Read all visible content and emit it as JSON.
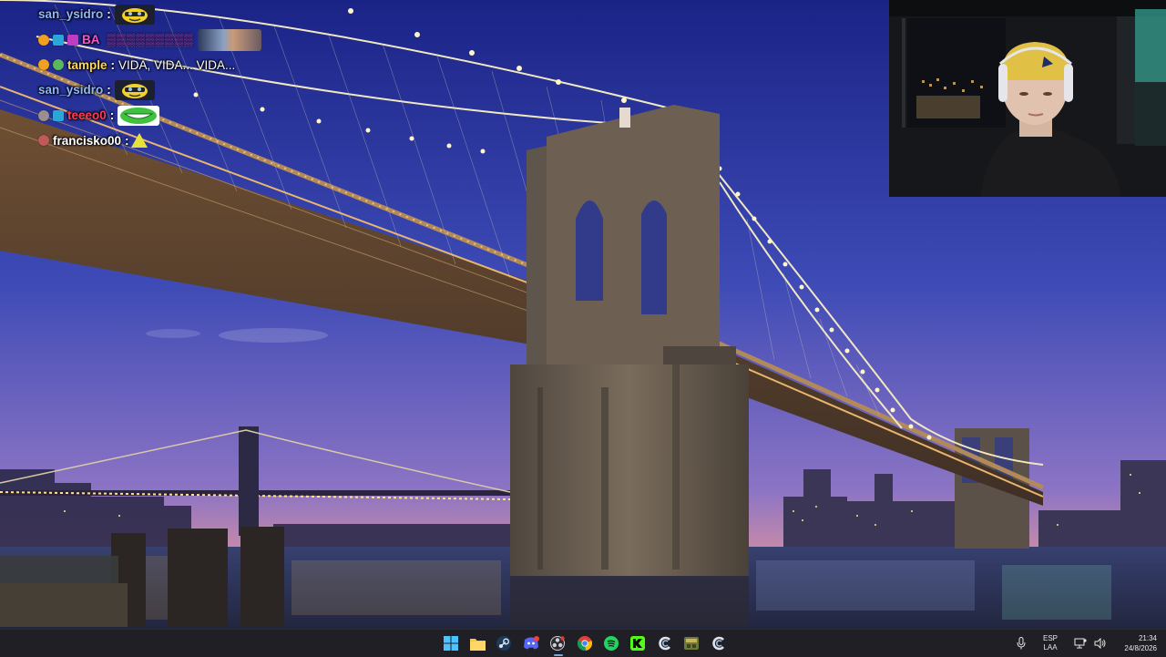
{
  "chat": {
    "messages": [
      {
        "username": "san_ysidro",
        "separator": ":",
        "text": "",
        "username_color": "#8fb7ff",
        "emote": "pepe-emote"
      },
      {
        "username": "BA",
        "separator": "",
        "text": "",
        "username_color": "#ff4fd8",
        "emote": "avatar-emote"
      },
      {
        "username": "tample",
        "separator": ":",
        "text": "VIDA, VIDA... VIDA...",
        "username_color": "#ffd94a",
        "emote": ""
      },
      {
        "username": "san_ysidro",
        "separator": ":",
        "text": "",
        "username_color": "#8fb7ff",
        "emote": "pepe-emote"
      },
      {
        "username": "teeeo0",
        "separator": ":",
        "text": "",
        "username_color": "#ff3b53",
        "emote": "grin-emote"
      },
      {
        "username": "francisko00",
        "separator": ":",
        "text": "",
        "username_color": "#ffffff",
        "emote": "cone-emote"
      }
    ]
  },
  "taskbar": {
    "apps": [
      {
        "name": "windows-start-icon"
      },
      {
        "name": "file-explorer-icon"
      },
      {
        "name": "steam-icon"
      },
      {
        "name": "discord-icon",
        "badge": "99+"
      },
      {
        "name": "obs-icon"
      },
      {
        "name": "chrome-icon"
      },
      {
        "name": "spotify-icon"
      },
      {
        "name": "kick-icon"
      },
      {
        "name": "ccleaner-icon"
      },
      {
        "name": "game-icon"
      },
      {
        "name": "ccleaner2-icon"
      }
    ],
    "tray": {
      "lang_line1": "ESP",
      "lang_line2": "LAA",
      "time": "21:34",
      "date": "24/8/2026"
    }
  },
  "colors": {
    "sky_top": "#1e2a8c",
    "sky_bottom": "#8f6fbf",
    "taskbar": "#1f1f25",
    "bridge_light": "#fff6c8"
  }
}
